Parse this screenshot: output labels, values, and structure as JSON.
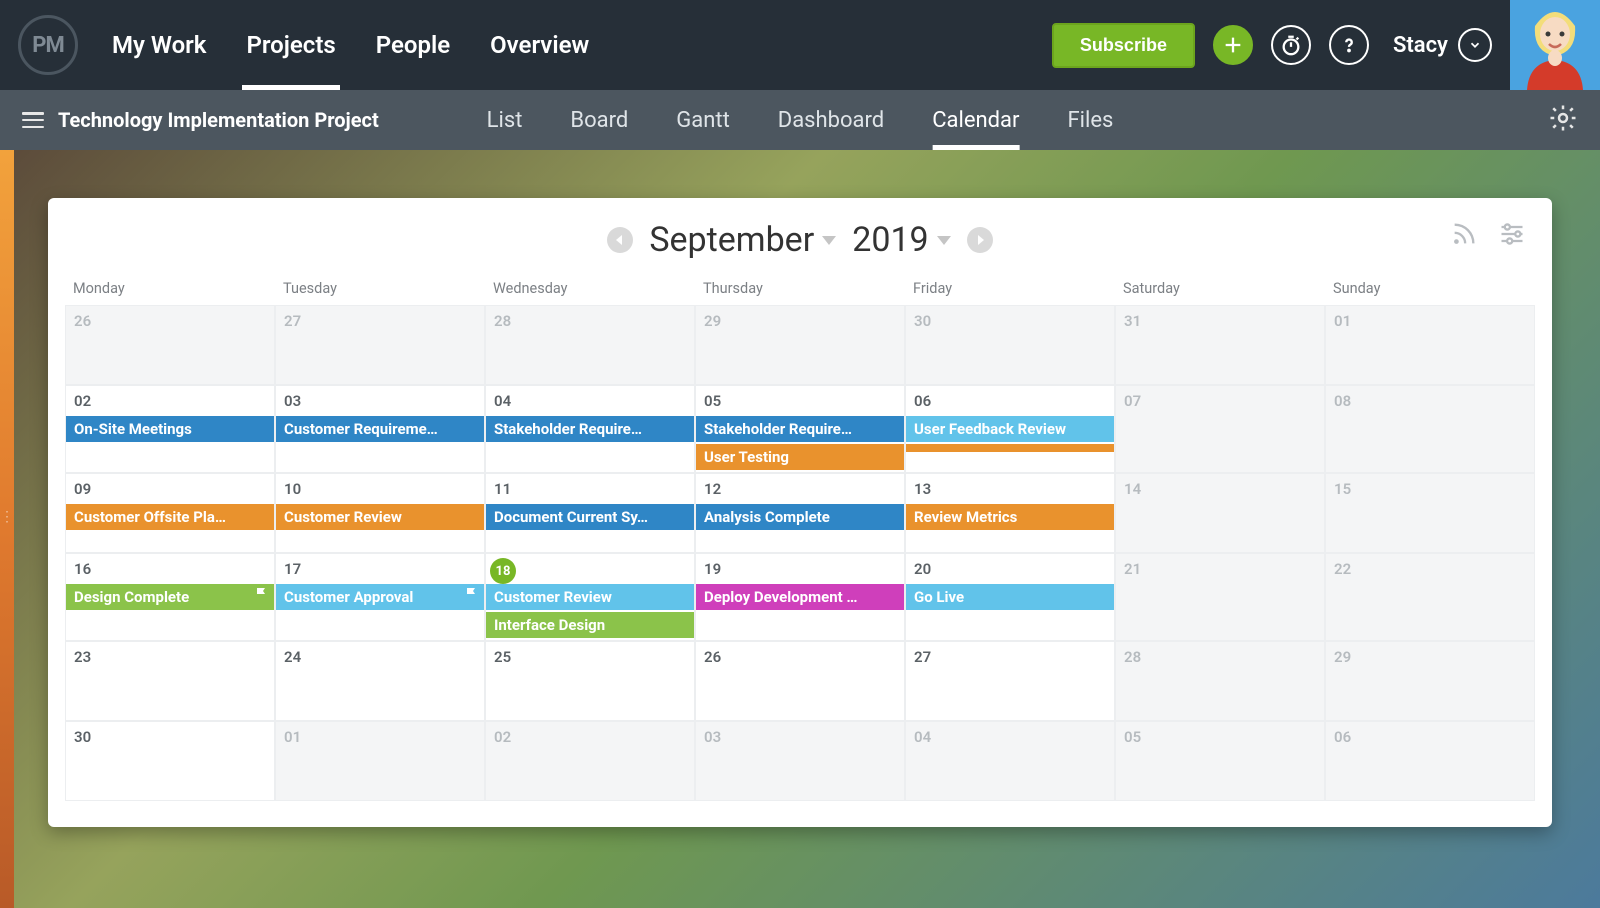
{
  "brand": {
    "logo_text": "PM"
  },
  "main_nav": {
    "items": [
      "My Work",
      "Projects",
      "People",
      "Overview"
    ],
    "active_index": 1
  },
  "header_actions": {
    "subscribe_label": "Subscribe",
    "user_name": "Stacy"
  },
  "project": {
    "title": "Technology Implementation Project"
  },
  "view_tabs": {
    "items": [
      "List",
      "Board",
      "Gantt",
      "Dashboard",
      "Calendar",
      "Files"
    ],
    "active_index": 4
  },
  "calendar": {
    "month_label": "September",
    "year_label": "2019",
    "dow": [
      "Monday",
      "Tuesday",
      "Wednesday",
      "Thursday",
      "Friday",
      "Saturday",
      "Sunday"
    ],
    "today_day": "18",
    "weeks": [
      {
        "days": [
          {
            "n": "26",
            "out": true,
            "events": []
          },
          {
            "n": "27",
            "out": true,
            "events": []
          },
          {
            "n": "28",
            "out": true,
            "events": []
          },
          {
            "n": "29",
            "out": true,
            "events": []
          },
          {
            "n": "30",
            "out": true,
            "events": []
          },
          {
            "n": "31",
            "out": true,
            "events": []
          },
          {
            "n": "01",
            "out": true,
            "events": []
          }
        ]
      },
      {
        "days": [
          {
            "n": "02",
            "events": [
              {
                "t": "On-Site Meetings",
                "c": "blue"
              }
            ]
          },
          {
            "n": "03",
            "events": [
              {
                "t": "Customer Requireme…",
                "c": "blue"
              }
            ]
          },
          {
            "n": "04",
            "events": [
              {
                "t": "Stakeholder Require…",
                "c": "blue"
              }
            ]
          },
          {
            "n": "05",
            "events": [
              {
                "t": "Stakeholder Require…",
                "c": "blue"
              },
              {
                "t": "User Testing",
                "c": "orange"
              }
            ]
          },
          {
            "n": "06",
            "events": [
              {
                "t": "User Feedback Review",
                "c": "lightblue"
              },
              {
                "t": " ",
                "c": "orange"
              }
            ]
          },
          {
            "n": "07",
            "out": true,
            "events": []
          },
          {
            "n": "08",
            "out": true,
            "events": []
          }
        ]
      },
      {
        "days": [
          {
            "n": "09",
            "events": [
              {
                "t": "Customer Offsite Pla…",
                "c": "orange"
              }
            ]
          },
          {
            "n": "10",
            "events": [
              {
                "t": "Customer Review",
                "c": "orange"
              }
            ]
          },
          {
            "n": "11",
            "events": [
              {
                "t": "Document Current Sy…",
                "c": "blue"
              }
            ]
          },
          {
            "n": "12",
            "events": [
              {
                "t": "Analysis Complete",
                "c": "blue"
              }
            ]
          },
          {
            "n": "13",
            "events": [
              {
                "t": "Review Metrics",
                "c": "orange"
              }
            ]
          },
          {
            "n": "14",
            "out": true,
            "events": []
          },
          {
            "n": "15",
            "out": true,
            "events": []
          }
        ]
      },
      {
        "days": [
          {
            "n": "16",
            "events": [
              {
                "t": "Design Complete",
                "c": "green",
                "flag": true
              }
            ]
          },
          {
            "n": "17",
            "events": [
              {
                "t": "Customer Approval",
                "c": "lightblue",
                "flag": true
              }
            ]
          },
          {
            "n": "18",
            "today": true,
            "events": [
              {
                "t": "Customer Review",
                "c": "lightblue"
              },
              {
                "t": "Interface Design",
                "c": "green"
              }
            ]
          },
          {
            "n": "19",
            "events": [
              {
                "t": "Deploy Development …",
                "c": "magenta"
              }
            ]
          },
          {
            "n": "20",
            "events": [
              {
                "t": "Go Live",
                "c": "lightblue"
              }
            ]
          },
          {
            "n": "21",
            "out": true,
            "events": []
          },
          {
            "n": "22",
            "out": true,
            "events": []
          }
        ]
      },
      {
        "days": [
          {
            "n": "23",
            "events": []
          },
          {
            "n": "24",
            "events": []
          },
          {
            "n": "25",
            "events": []
          },
          {
            "n": "26",
            "events": []
          },
          {
            "n": "27",
            "events": []
          },
          {
            "n": "28",
            "out": true,
            "events": []
          },
          {
            "n": "29",
            "out": true,
            "events": []
          }
        ]
      },
      {
        "days": [
          {
            "n": "30",
            "events": []
          },
          {
            "n": "01",
            "out": true,
            "events": []
          },
          {
            "n": "02",
            "out": true,
            "events": []
          },
          {
            "n": "03",
            "out": true,
            "events": []
          },
          {
            "n": "04",
            "out": true,
            "events": []
          },
          {
            "n": "05",
            "out": true,
            "events": []
          },
          {
            "n": "06",
            "out": true,
            "events": []
          }
        ]
      }
    ],
    "colors": {
      "blue": "#2f86c6",
      "lightblue": "#61c3ea",
      "orange": "#e9922d",
      "green": "#8bc34a",
      "magenta": "#cf3fbb"
    }
  }
}
